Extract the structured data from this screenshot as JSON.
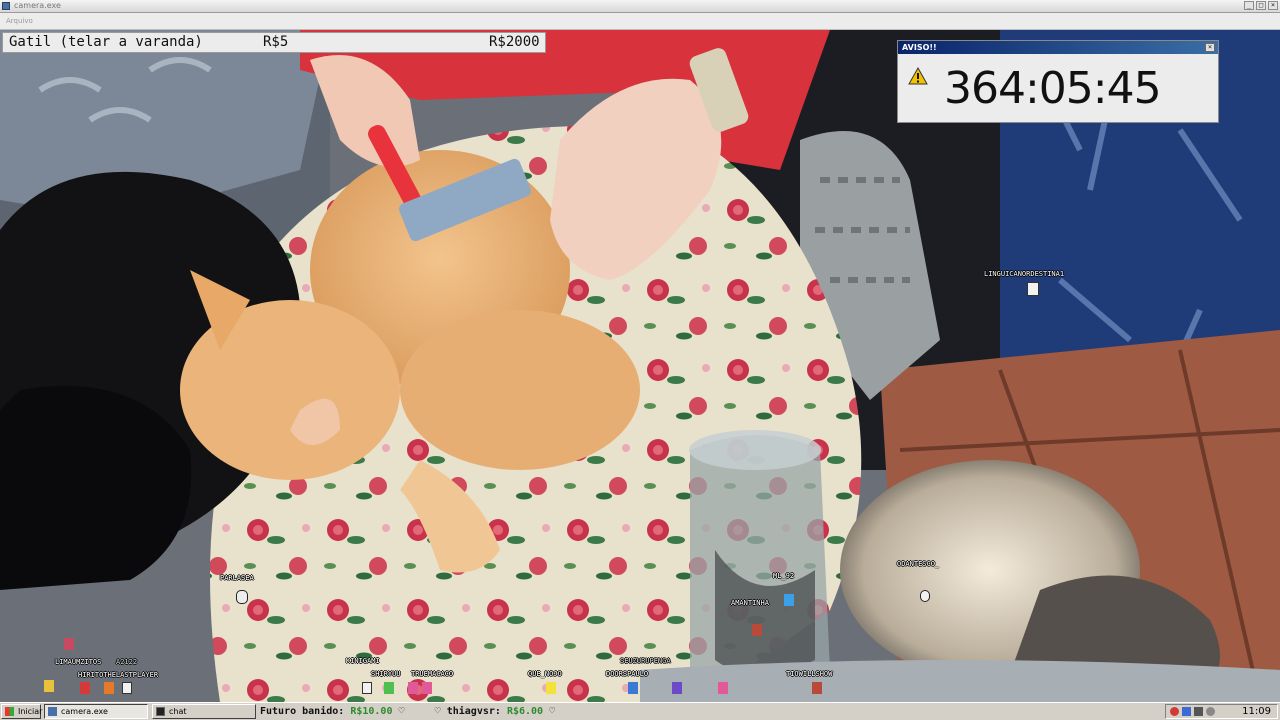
{
  "window": {
    "title": "camera.exe",
    "menu": "Arquivo",
    "controls": [
      "_",
      "□",
      "×"
    ]
  },
  "goal": {
    "item": "Gatil (telar a varanda)",
    "current": "R$5",
    "target": "R$2000"
  },
  "aviso": {
    "title": "AVISO!!",
    "timer": "364:05:45",
    "icon": "warning-icon"
  },
  "chat_users": [
    {
      "name": "linguicanordestina1"
    },
    {
      "name": "parlasea"
    },
    {
      "name": "limaumzitos"
    },
    {
      "name": "a2122"
    },
    {
      "name": "hiritothelastplayer"
    },
    {
      "name": "kinigami"
    },
    {
      "name": "shiryuu"
    },
    {
      "name": "truemacaco"
    },
    {
      "name": "que_nojo"
    },
    {
      "name": "seuzurupenga"
    },
    {
      "name": "doorspaulo"
    },
    {
      "name": "ml_92"
    },
    {
      "name": "amantinha"
    },
    {
      "name": "tiowillshow"
    },
    {
      "name": "odantesco_"
    }
  ],
  "taskbar": {
    "start": "Iniciar",
    "windows": [
      {
        "label": "camera.exe",
        "active": true
      },
      {
        "label": "chat",
        "active": false
      }
    ],
    "ticker": {
      "u1": "Futuro banido:",
      "a1": "R$10.00",
      "u2": "thiagvsr:",
      "a2": "R$6.00",
      "heart": "♡"
    },
    "clock": "11:09"
  },
  "colors": {
    "taskbar": "#d4d0c8",
    "titlebar_active": "#0a246a",
    "donation_amount": "#2e8b2e"
  }
}
